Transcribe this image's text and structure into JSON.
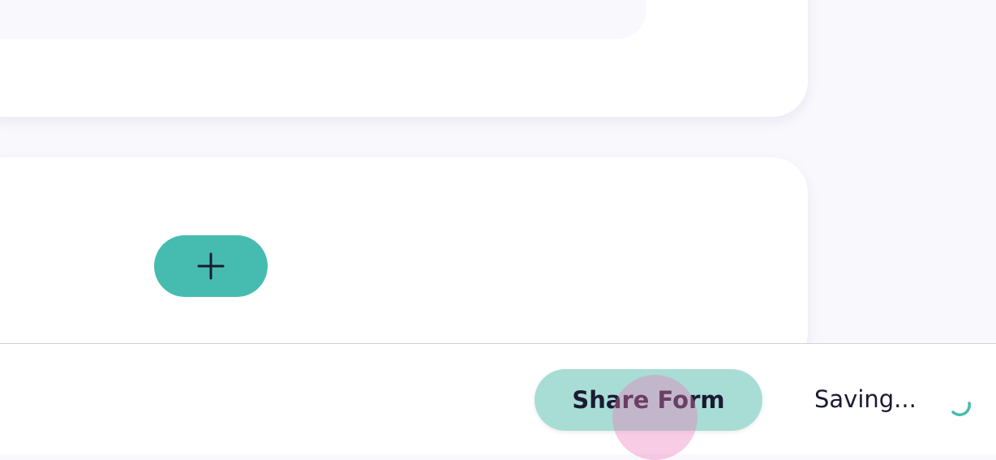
{
  "footer": {
    "share_button_label": "Share Form",
    "status_text": "Saving..."
  },
  "icons": {
    "add": "plus-icon",
    "loading": "spinner-icon"
  },
  "colors": {
    "accent": "#46bcb0",
    "share_button_bg": "#a8ddd5",
    "text": "#1b1a33",
    "background": "#f9f8fd",
    "click_indicator": "#ec78b9"
  }
}
